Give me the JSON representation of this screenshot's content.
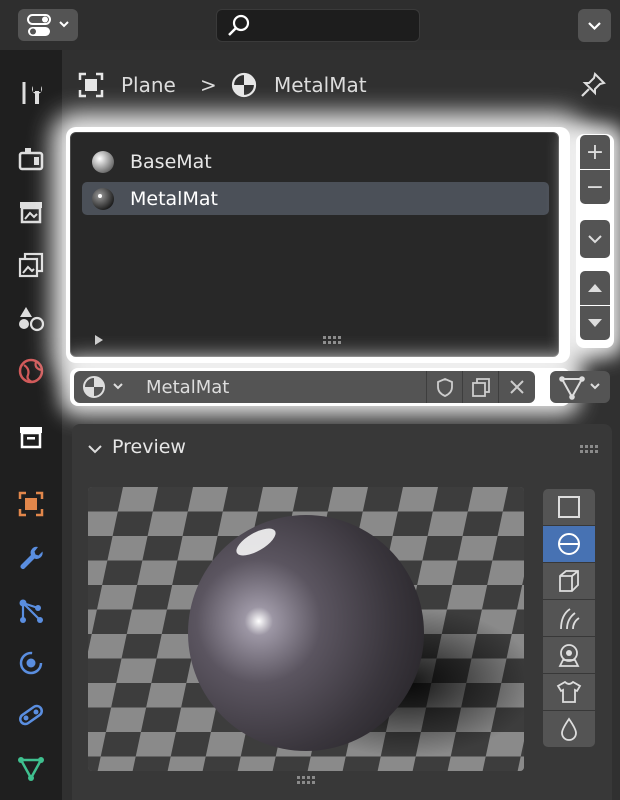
{
  "breadcrumb": {
    "object": "Plane",
    "separator": ">",
    "material": "MetalMat"
  },
  "material_slots": [
    {
      "name": "BaseMat",
      "selected": false
    },
    {
      "name": "MetalMat",
      "selected": true
    }
  ],
  "slot_buttons": {
    "add": "+",
    "remove": "−"
  },
  "material_datablock": {
    "name": "MetalMat"
  },
  "preview": {
    "title": "Preview",
    "tools": [
      "flat-icon",
      "sphere-icon",
      "cube-icon",
      "hair-icon",
      "shader-ball-icon",
      "cloth-icon",
      "fluid-icon"
    ],
    "active_tool": 1
  },
  "colors": {
    "accent": "#4772b3",
    "highlight_glow": "#ffffff",
    "panel_bg": "#303030"
  }
}
